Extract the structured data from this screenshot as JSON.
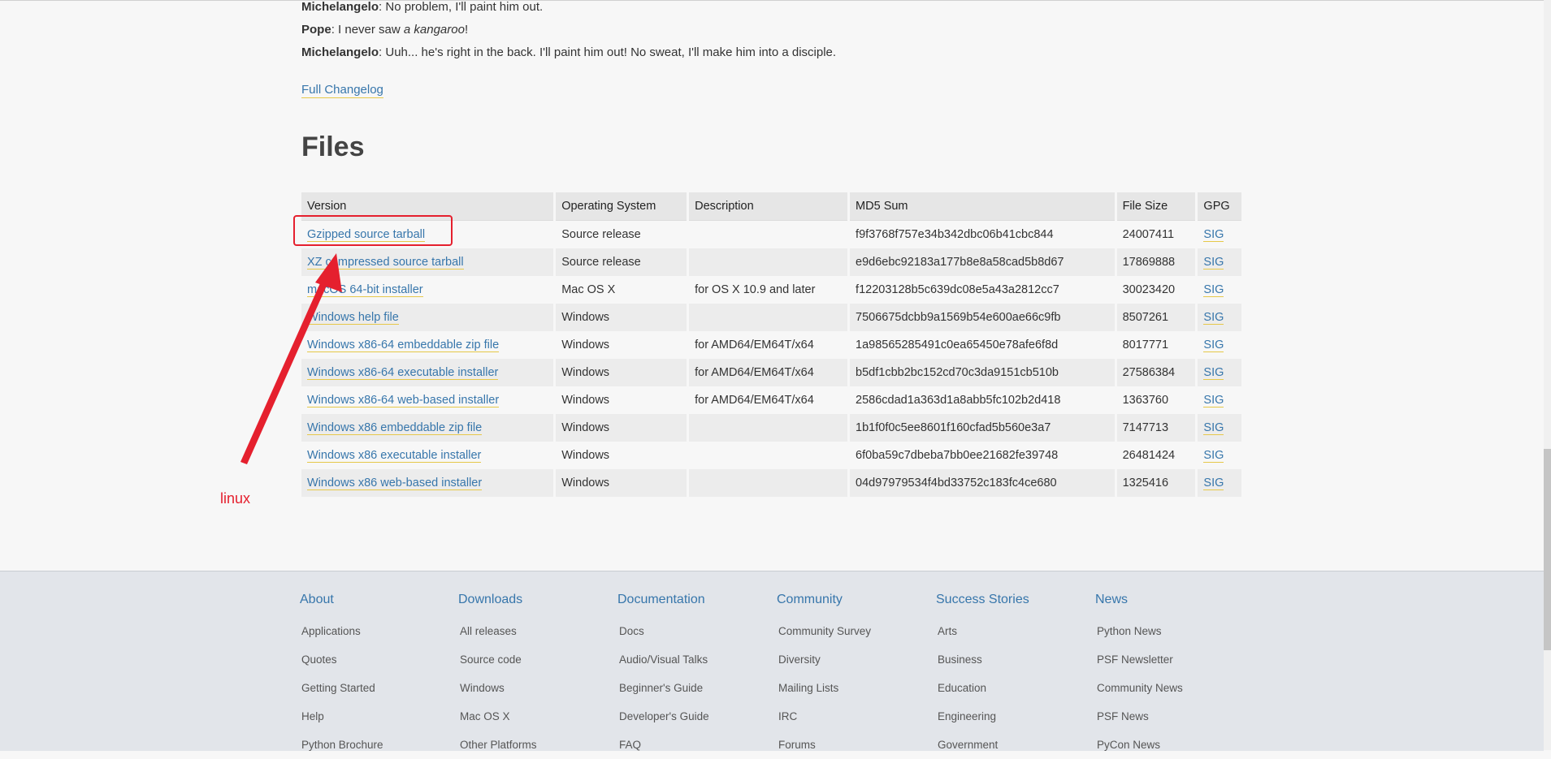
{
  "dialog": [
    {
      "speaker": "Michelangelo",
      "pre": ": No problem, I'll paint him out.",
      "em": "",
      "post": ""
    },
    {
      "speaker": "Pope",
      "pre": ": I never saw ",
      "em": "a kangaroo",
      "post": "!"
    },
    {
      "speaker": "Michelangelo",
      "pre": ": Uuh... he's right in the back. I'll paint him out! No sweat, I'll make him into a disciple.",
      "em": "",
      "post": ""
    }
  ],
  "changelog_link": "Full Changelog",
  "files_heading": "Files",
  "table": {
    "headers": [
      "Version",
      "Operating System",
      "Description",
      "MD5 Sum",
      "File Size",
      "GPG"
    ],
    "rows": [
      {
        "version": "Gzipped source tarball",
        "os": "Source release",
        "desc": "",
        "md5": "f9f3768f757e34b342dbc06b41cbc844",
        "size": "24007411",
        "gpg": "SIG"
      },
      {
        "version": "XZ compressed source tarball",
        "os": "Source release",
        "desc": "",
        "md5": "e9d6ebc92183a177b8e8a58cad5b8d67",
        "size": "17869888",
        "gpg": "SIG"
      },
      {
        "version": "macOS 64-bit installer",
        "os": "Mac OS X",
        "desc": "for OS X 10.9 and later",
        "md5": "f12203128b5c639dc08e5a43a2812cc7",
        "size": "30023420",
        "gpg": "SIG"
      },
      {
        "version": "Windows help file",
        "os": "Windows",
        "desc": "",
        "md5": "7506675dcbb9a1569b54e600ae66c9fb",
        "size": "8507261",
        "gpg": "SIG"
      },
      {
        "version": "Windows x86-64 embeddable zip file",
        "os": "Windows",
        "desc": "for AMD64/EM64T/x64",
        "md5": "1a98565285491c0ea65450e78afe6f8d",
        "size": "8017771",
        "gpg": "SIG"
      },
      {
        "version": "Windows x86-64 executable installer",
        "os": "Windows",
        "desc": "for AMD64/EM64T/x64",
        "md5": "b5df1cbb2bc152cd70c3da9151cb510b",
        "size": "27586384",
        "gpg": "SIG"
      },
      {
        "version": "Windows x86-64 web-based installer",
        "os": "Windows",
        "desc": "for AMD64/EM64T/x64",
        "md5": "2586cdad1a363d1a8abb5fc102b2d418",
        "size": "1363760",
        "gpg": "SIG"
      },
      {
        "version": "Windows x86 embeddable zip file",
        "os": "Windows",
        "desc": "",
        "md5": "1b1f0f0c5ee8601f160cfad5b560e3a7",
        "size": "7147713",
        "gpg": "SIG"
      },
      {
        "version": "Windows x86 executable installer",
        "os": "Windows",
        "desc": "",
        "md5": "6f0ba59c7dbeba7bb0ee21682fe39748",
        "size": "26481424",
        "gpg": "SIG"
      },
      {
        "version": "Windows x86 web-based installer",
        "os": "Windows",
        "desc": "",
        "md5": "04d97979534f4bd33752c183fc4ce680",
        "size": "1325416",
        "gpg": "SIG"
      }
    ]
  },
  "annotation": {
    "note": "linux",
    "color": "#e5202e"
  },
  "footer": {
    "columns": [
      {
        "title": "About",
        "items": [
          "Applications",
          "Quotes",
          "Getting Started",
          "Help",
          "Python Brochure"
        ]
      },
      {
        "title": "Downloads",
        "items": [
          "All releases",
          "Source code",
          "Windows",
          "Mac OS X",
          "Other Platforms"
        ]
      },
      {
        "title": "Documentation",
        "items": [
          "Docs",
          "Audio/Visual Talks",
          "Beginner's Guide",
          "Developer's Guide",
          "FAQ"
        ]
      },
      {
        "title": "Community",
        "items": [
          "Community Survey",
          "Diversity",
          "Mailing Lists",
          "IRC",
          "Forums"
        ]
      },
      {
        "title": "Success Stories",
        "items": [
          "Arts",
          "Business",
          "Education",
          "Engineering",
          "Government"
        ]
      },
      {
        "title": "News",
        "items": [
          "Python News",
          "PSF Newsletter",
          "Community News",
          "PSF News",
          "PyCon News"
        ]
      }
    ]
  }
}
